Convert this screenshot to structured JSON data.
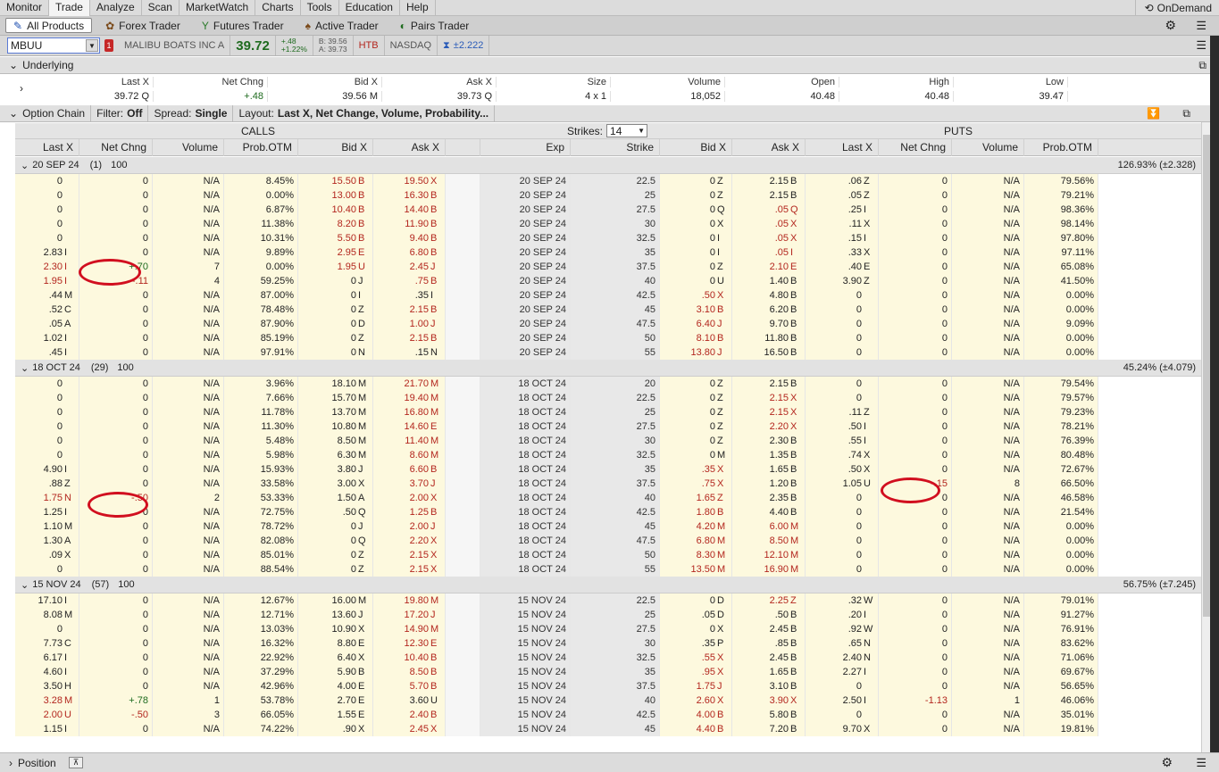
{
  "menu": [
    "Monitor",
    "Trade",
    "Analyze",
    "Scan",
    "MarketWatch",
    "Charts",
    "Tools",
    "Education",
    "Help"
  ],
  "ondemand": "OnDemand",
  "subtabs": [
    "All Products",
    "Forex Trader",
    "Futures Trader",
    "Active Trader",
    "Pairs Trader"
  ],
  "symbol": {
    "value": "MBUU",
    "flag": "1",
    "name": "MALIBU BOATS INC A",
    "last": "39.72",
    "chg": "+.48",
    "chgpct": "+1.22%",
    "bid": "B: 39.56",
    "ask": "A: 39.73",
    "htb": "HTB",
    "exchange": "NASDAQ",
    "impl": "±2.222"
  },
  "underlying": {
    "title": "Underlying",
    "headers": [
      "Last X",
      "Net Chng",
      "Bid X",
      "Ask X",
      "Size",
      "Volume",
      "Open",
      "High",
      "Low"
    ],
    "values": [
      "39.72 Q",
      "+.48",
      "39.56 M",
      "39.73 Q",
      "4 x 1",
      "18,052",
      "40.48",
      "40.48",
      "39.47"
    ]
  },
  "chainbar": {
    "title": "Option Chain",
    "filter_label": "Filter:",
    "filter": "Off",
    "spread_label": "Spread:",
    "spread": "Single",
    "layout_label": "Layout:",
    "layout": "Last X, Net Change, Volume, Probability..."
  },
  "calls_label": "CALLS",
  "puts_label": "PUTS",
  "strikes_label": "Strikes:",
  "strikes": "14",
  "columns": {
    "calls": [
      "Last X",
      "Net Chng",
      "Volume",
      "Prob.OTM",
      "Bid X",
      "Ask X"
    ],
    "mid": [
      "Exp",
      "Strike"
    ],
    "puts": [
      "Bid X",
      "Ask X",
      "Last X",
      "Net Chng",
      "Volume",
      "Prob.OTM"
    ]
  },
  "expirations": [
    {
      "label": "20 SEP 24",
      "days": "(1)",
      "mult": "100",
      "iv": "126.93% (±2.328)",
      "rows": [
        [
          "0",
          "",
          "0",
          "N/A",
          "8.45%",
          "15.50",
          "B",
          "19.50",
          "X",
          "20 SEP 24",
          "22.5",
          "0",
          "Z",
          "2.15",
          "B",
          ".06",
          "Z",
          "0",
          "N/A",
          "79.56%"
        ],
        [
          "0",
          "",
          "0",
          "N/A",
          "0.00%",
          "13.00",
          "B",
          "16.30",
          "B",
          "20 SEP 24",
          "25",
          "0",
          "Z",
          "2.15",
          "B",
          ".05",
          "Z",
          "0",
          "N/A",
          "79.21%"
        ],
        [
          "0",
          "",
          "0",
          "N/A",
          "6.87%",
          "10.40",
          "B",
          "14.40",
          "B",
          "20 SEP 24",
          "27.5",
          "0",
          "Q",
          ".05",
          "Q",
          ".25",
          "I",
          "0",
          "N/A",
          "98.36%"
        ],
        [
          "0",
          "",
          "0",
          "N/A",
          "11.38%",
          "8.20",
          "B",
          "11.90",
          "B",
          "20 SEP 24",
          "30",
          "0",
          "X",
          ".05",
          "X",
          ".11",
          "X",
          "0",
          "N/A",
          "98.14%"
        ],
        [
          "0",
          "",
          "0",
          "N/A",
          "10.31%",
          "5.50",
          "B",
          "9.40",
          "B",
          "20 SEP 24",
          "32.5",
          "0",
          "I",
          ".05",
          "X",
          ".15",
          "I",
          "0",
          "N/A",
          "97.80%"
        ],
        [
          "2.83",
          "I",
          "0",
          "N/A",
          "9.89%",
          "2.95",
          "E",
          "6.80",
          "B",
          "20 SEP 24",
          "35",
          "0",
          "I",
          ".05",
          "I",
          ".33",
          "X",
          "0",
          "N/A",
          "97.11%"
        ],
        [
          "2.30",
          "I",
          "+.70",
          "7",
          "0.00%",
          "1.95",
          "U",
          "2.45",
          "J",
          "20 SEP 24",
          "37.5",
          "0",
          "Z",
          "2.10",
          "E",
          ".40",
          "E",
          "0",
          "N/A",
          "65.08%"
        ],
        [
          "1.95",
          "I",
          "-.11",
          "4",
          "59.25%",
          "0",
          "J",
          ".75",
          "B",
          "20 SEP 24",
          "40",
          "0",
          "U",
          "1.40",
          "B",
          "3.90",
          "Z",
          "0",
          "N/A",
          "41.50%"
        ],
        [
          ".44",
          "M",
          "0",
          "N/A",
          "87.00%",
          "0",
          "I",
          ".35",
          "I",
          "20 SEP 24",
          "42.5",
          ".50",
          "X",
          "4.80",
          "B",
          "0",
          "",
          "0",
          "N/A",
          "0.00%"
        ],
        [
          ".52",
          "C",
          "0",
          "N/A",
          "78.48%",
          "0",
          "Z",
          "2.15",
          "B",
          "20 SEP 24",
          "45",
          "3.10",
          "B",
          "6.20",
          "B",
          "0",
          "",
          "0",
          "N/A",
          "0.00%"
        ],
        [
          ".05",
          "A",
          "0",
          "N/A",
          "87.90%",
          "0",
          "D",
          "1.00",
          "J",
          "20 SEP 24",
          "47.5",
          "6.40",
          "J",
          "9.70",
          "B",
          "0",
          "",
          "0",
          "N/A",
          "9.09%"
        ],
        [
          "1.02",
          "I",
          "0",
          "N/A",
          "85.19%",
          "0",
          "Z",
          "2.15",
          "B",
          "20 SEP 24",
          "50",
          "8.10",
          "B",
          "11.80",
          "B",
          "0",
          "",
          "0",
          "N/A",
          "0.00%"
        ],
        [
          ".45",
          "I",
          "0",
          "N/A",
          "97.91%",
          "0",
          "N",
          ".15",
          "N",
          "20 SEP 24",
          "55",
          "13.80",
          "J",
          "16.50",
          "B",
          "0",
          "",
          "0",
          "N/A",
          "0.00%"
        ]
      ]
    },
    {
      "label": "18 OCT 24",
      "days": "(29)",
      "mult": "100",
      "iv": "45.24% (±4.079)",
      "rows": [
        [
          "0",
          "",
          "0",
          "N/A",
          "3.96%",
          "18.10",
          "M",
          "21.70",
          "M",
          "18 OCT 24",
          "20",
          "0",
          "Z",
          "2.15",
          "B",
          "0",
          "",
          "0",
          "N/A",
          "79.54%"
        ],
        [
          "0",
          "",
          "0",
          "N/A",
          "7.66%",
          "15.70",
          "M",
          "19.40",
          "M",
          "18 OCT 24",
          "22.5",
          "0",
          "Z",
          "2.15",
          "X",
          "0",
          "",
          "0",
          "N/A",
          "79.57%"
        ],
        [
          "0",
          "",
          "0",
          "N/A",
          "11.78%",
          "13.70",
          "M",
          "16.80",
          "M",
          "18 OCT 24",
          "25",
          "0",
          "Z",
          "2.15",
          "X",
          ".11",
          "Z",
          "0",
          "N/A",
          "79.23%"
        ],
        [
          "0",
          "",
          "0",
          "N/A",
          "11.30%",
          "10.80",
          "M",
          "14.60",
          "E",
          "18 OCT 24",
          "27.5",
          "0",
          "Z",
          "2.20",
          "X",
          ".50",
          "I",
          "0",
          "N/A",
          "78.21%"
        ],
        [
          "0",
          "",
          "0",
          "N/A",
          "5.48%",
          "8.50",
          "M",
          "11.40",
          "M",
          "18 OCT 24",
          "30",
          "0",
          "Z",
          "2.30",
          "B",
          ".55",
          "I",
          "0",
          "N/A",
          "76.39%"
        ],
        [
          "0",
          "",
          "0",
          "N/A",
          "5.98%",
          "6.30",
          "M",
          "8.60",
          "M",
          "18 OCT 24",
          "32.5",
          "0",
          "M",
          "1.35",
          "B",
          ".74",
          "X",
          "0",
          "N/A",
          "80.48%"
        ],
        [
          "4.90",
          "I",
          "0",
          "N/A",
          "15.93%",
          "3.80",
          "J",
          "6.60",
          "B",
          "18 OCT 24",
          "35",
          ".35",
          "X",
          "1.65",
          "B",
          ".50",
          "X",
          "0",
          "N/A",
          "72.67%"
        ],
        [
          ".88",
          "Z",
          "0",
          "N/A",
          "33.58%",
          "3.00",
          "X",
          "3.70",
          "J",
          "18 OCT 24",
          "37.5",
          ".75",
          "X",
          "1.20",
          "B",
          "1.05",
          "U",
          "-.15",
          "8",
          "66.50%"
        ],
        [
          "1.75",
          "N",
          "-.50",
          "2",
          "53.33%",
          "1.50",
          "A",
          "2.00",
          "X",
          "18 OCT 24",
          "40",
          "1.65",
          "Z",
          "2.35",
          "B",
          "0",
          "",
          "0",
          "N/A",
          "46.58%"
        ],
        [
          "1.25",
          "I",
          "0",
          "N/A",
          "72.75%",
          ".50",
          "Q",
          "1.25",
          "B",
          "18 OCT 24",
          "42.5",
          "1.80",
          "B",
          "4.40",
          "B",
          "0",
          "",
          "0",
          "N/A",
          "21.54%"
        ],
        [
          "1.10",
          "M",
          "0",
          "N/A",
          "78.72%",
          "0",
          "J",
          "2.00",
          "J",
          "18 OCT 24",
          "45",
          "4.20",
          "M",
          "6.00",
          "M",
          "0",
          "",
          "0",
          "N/A",
          "0.00%"
        ],
        [
          "1.30",
          "A",
          "0",
          "N/A",
          "82.08%",
          "0",
          "Q",
          "2.20",
          "X",
          "18 OCT 24",
          "47.5",
          "6.80",
          "M",
          "8.50",
          "M",
          "0",
          "",
          "0",
          "N/A",
          "0.00%"
        ],
        [
          ".09",
          "X",
          "0",
          "N/A",
          "85.01%",
          "0",
          "Z",
          "2.15",
          "X",
          "18 OCT 24",
          "50",
          "8.30",
          "M",
          "12.10",
          "M",
          "0",
          "",
          "0",
          "N/A",
          "0.00%"
        ],
        [
          "0",
          "",
          "0",
          "N/A",
          "88.54%",
          "0",
          "Z",
          "2.15",
          "X",
          "18 OCT 24",
          "55",
          "13.50",
          "M",
          "16.90",
          "M",
          "0",
          "",
          "0",
          "N/A",
          "0.00%"
        ]
      ]
    },
    {
      "label": "15 NOV 24",
      "days": "(57)",
      "mult": "100",
      "iv": "56.75% (±7.245)",
      "rows": [
        [
          "17.10",
          "I",
          "0",
          "N/A",
          "12.67%",
          "16.00",
          "M",
          "19.80",
          "M",
          "15 NOV 24",
          "22.5",
          "0",
          "D",
          "2.25",
          "Z",
          ".32",
          "W",
          "0",
          "N/A",
          "79.01%"
        ],
        [
          "8.08",
          "M",
          "0",
          "N/A",
          "12.71%",
          "13.60",
          "J",
          "17.20",
          "J",
          "15 NOV 24",
          "25",
          ".05",
          "D",
          ".50",
          "B",
          ".20",
          "I",
          "0",
          "N/A",
          "91.27%"
        ],
        [
          "0",
          "",
          "0",
          "N/A",
          "13.03%",
          "10.90",
          "X",
          "14.90",
          "M",
          "15 NOV 24",
          "27.5",
          "0",
          "X",
          "2.45",
          "B",
          ".92",
          "W",
          "0",
          "N/A",
          "76.91%"
        ],
        [
          "7.73",
          "C",
          "0",
          "N/A",
          "16.32%",
          "8.80",
          "E",
          "12.30",
          "E",
          "15 NOV 24",
          "30",
          ".35",
          "P",
          ".85",
          "B",
          ".65",
          "N",
          "0",
          "N/A",
          "83.62%"
        ],
        [
          "6.17",
          "I",
          "0",
          "N/A",
          "22.92%",
          "6.40",
          "X",
          "10.40",
          "B",
          "15 NOV 24",
          "32.5",
          ".55",
          "X",
          "2.45",
          "B",
          "2.40",
          "N",
          "0",
          "N/A",
          "71.06%"
        ],
        [
          "4.60",
          "I",
          "0",
          "N/A",
          "37.29%",
          "5.90",
          "B",
          "8.50",
          "B",
          "15 NOV 24",
          "35",
          ".95",
          "X",
          "1.65",
          "B",
          "2.27",
          "I",
          "0",
          "N/A",
          "69.67%"
        ],
        [
          "3.50",
          "H",
          "0",
          "N/A",
          "42.96%",
          "4.00",
          "E",
          "5.70",
          "B",
          "15 NOV 24",
          "37.5",
          "1.75",
          "J",
          "3.10",
          "B",
          "0",
          "",
          "0",
          "N/A",
          "56.65%"
        ],
        [
          "3.28",
          "M",
          "+.78",
          "1",
          "53.78%",
          "2.70",
          "E",
          "3.60",
          "U",
          "15 NOV 24",
          "40",
          "2.60",
          "X",
          "3.90",
          "X",
          "2.50",
          "I",
          "-1.13",
          "1",
          "46.06%"
        ],
        [
          "2.00",
          "U",
          "-.50",
          "3",
          "66.05%",
          "1.55",
          "E",
          "2.40",
          "B",
          "15 NOV 24",
          "42.5",
          "4.00",
          "B",
          "5.80",
          "B",
          "0",
          "",
          "0",
          "N/A",
          "35.01%"
        ],
        [
          "1.15",
          "I",
          "0",
          "N/A",
          "74.22%",
          ".90",
          "X",
          "2.45",
          "X",
          "15 NOV 24",
          "45",
          "4.40",
          "B",
          "7.20",
          "B",
          "9.70",
          "X",
          "0",
          "N/A",
          "19.81%"
        ]
      ]
    }
  ],
  "footer": {
    "label": "Position"
  }
}
